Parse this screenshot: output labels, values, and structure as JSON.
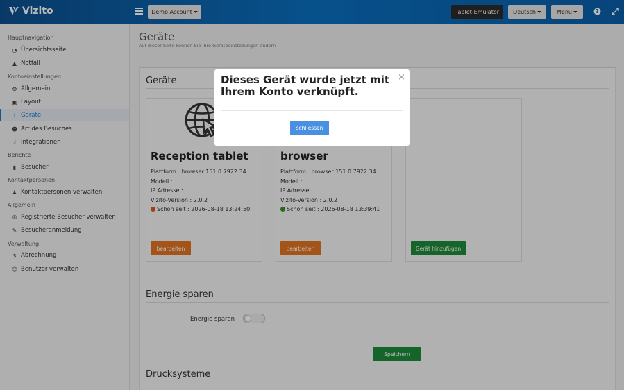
{
  "brand": {
    "name": "Vizito"
  },
  "topbar": {
    "account_label": "Demo Account",
    "emulator_label": "Tablet-Emulator",
    "language_label": "Deutsch",
    "menu_label": "Menü",
    "help_icon": "question-circle-icon",
    "expand_icon": "expand-icon"
  },
  "sidebar": {
    "sections": {
      "main_nav": "Hauptnavigation",
      "account_settings": "Kontoeinstellungen",
      "reports": "Berichte",
      "contacts": "Kontaktpersonen",
      "general": "Allgemein",
      "admin": "Verwaltung"
    },
    "items": [
      {
        "label": "Übersichtsseite",
        "icon": "dashboard-icon"
      },
      {
        "label": "Notfall",
        "icon": "warning-icon"
      },
      {
        "label": "Allgemein",
        "icon": "gear-icon"
      },
      {
        "label": "Layout",
        "icon": "image-icon"
      },
      {
        "label": "Geräte",
        "icon": "sitemap-icon",
        "active": true
      },
      {
        "label": "Art des Besuches",
        "icon": "users-icon"
      },
      {
        "label": "Integrationen",
        "icon": "plug-icon"
      },
      {
        "label": "Besucher",
        "icon": "book-icon"
      },
      {
        "label": "Kontaktpersonen verwalten",
        "icon": "person-icon"
      },
      {
        "label": "Registrierte Besucher verwalten",
        "icon": "registered-icon"
      },
      {
        "label": "Besucheranmeldung",
        "icon": "pencil-icon"
      },
      {
        "label": "Abrechnung",
        "icon": "dollar-icon"
      },
      {
        "label": "Benutzer verwalten",
        "icon": "user-gear-icon"
      }
    ]
  },
  "page": {
    "title": "Geräte",
    "subtitle": "Auf dieser Seite können Sie Ihre Geräteeinstellungen ändern"
  },
  "devices_section": {
    "heading": "Geräte"
  },
  "devices": [
    {
      "name": "Reception tablet",
      "platform": "Plattform : browser 151.0.7922.34",
      "model": "Modell :",
      "ip": "IP Adresse :",
      "version": "Vizito-Version : 2.0.2",
      "since": "Schon seit : 2026-08-18 13:24:50",
      "status_color": "#d9581c",
      "edit_label": "bearbeiten"
    },
    {
      "name": "browser",
      "platform": "Plattform : browser 151.0.7922.34",
      "model": "Modell :",
      "ip": "IP Adresse :",
      "version": "Vizito-Version : 2.0.2",
      "since": "Schon seit : 2026-08-18 13:39:41",
      "status_color": "#3b8f26",
      "edit_label": "bearbeiten"
    }
  ],
  "add_device_label": "Gerät hinzufügen",
  "energy": {
    "heading": "Energie sparen",
    "label": "Energie sparen",
    "enabled": false,
    "save_label": "Speichern"
  },
  "print": {
    "heading": "Drucksysteme"
  },
  "modal": {
    "title": "Dieses Gerät wurde jetzt mit Ihrem Konto verknüpft.",
    "close_symbol": "×",
    "button_label": "schliessen"
  },
  "colors": {
    "topbar": "#0a6fbf",
    "accent": "#1a7ac9",
    "edit_button": "#e17422",
    "green_button": "#1e8a3a",
    "modal_button": "#4a90e2"
  }
}
